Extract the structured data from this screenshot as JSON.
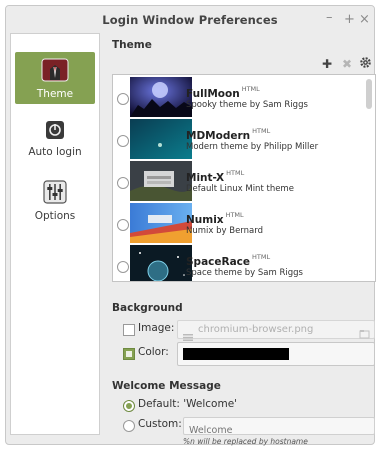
{
  "window": {
    "title": "Login Window Preferences",
    "min": "–",
    "max": "+",
    "close": "×"
  },
  "sidebar": {
    "items": [
      {
        "label": "Theme",
        "icon": "theme-icon",
        "active": true
      },
      {
        "label": "Auto login",
        "icon": "autologin-icon",
        "active": false
      },
      {
        "label": "Options",
        "icon": "options-icon",
        "active": false
      }
    ]
  },
  "theme": {
    "heading": "Theme",
    "toolbar": {
      "add": "add-icon",
      "remove": "remove-icon",
      "settings": "gear-icon"
    },
    "items": [
      {
        "name": "FullMoon",
        "tag": "HTML",
        "description": "Spooky theme by Sam Riggs"
      },
      {
        "name": "MDModern",
        "tag": "HTML",
        "description": "Modern theme by Philipp Miller"
      },
      {
        "name": "Mint-X",
        "tag": "HTML",
        "description": "Default Linux Mint theme"
      },
      {
        "name": "Numix",
        "tag": "HTML",
        "description": "Numix by Bernard"
      },
      {
        "name": "SpaceRace",
        "tag": "HTML",
        "description": "Space theme by Sam Riggs"
      }
    ]
  },
  "background": {
    "heading": "Background",
    "image_label": "Image:",
    "image_value": "chromium-browser.png",
    "color_label": "Color:",
    "color_value": "#000000"
  },
  "welcome": {
    "heading": "Welcome Message",
    "default_label": "Default: 'Welcome'",
    "custom_label": "Custom:",
    "custom_placeholder": "Welcome",
    "hint": "%n will be replaced by hostname"
  },
  "colors": {
    "accent": "#85a152"
  }
}
